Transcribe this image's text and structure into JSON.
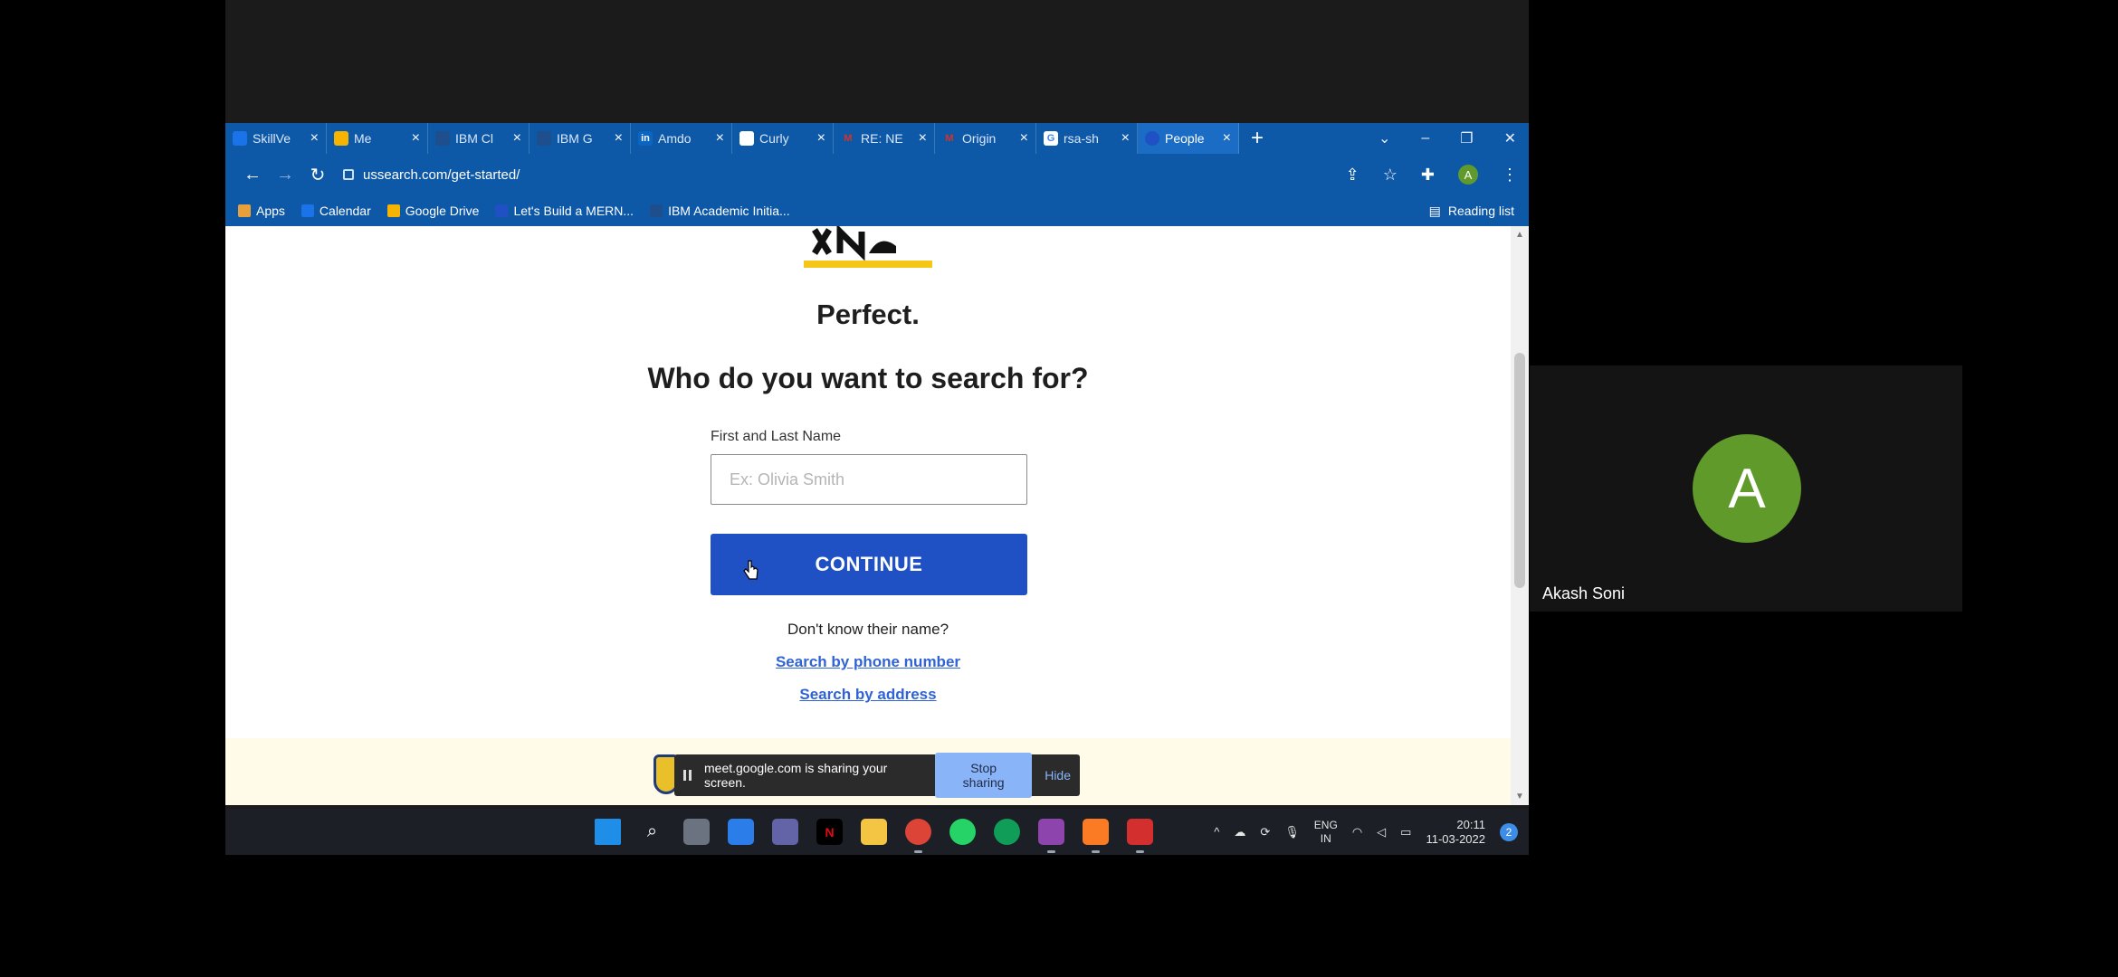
{
  "browser": {
    "tabs": [
      {
        "label": "SkillVe",
        "favicon_color": "#1a73e8"
      },
      {
        "label": "Me",
        "favicon_color": "#f4b400"
      },
      {
        "label": "IBM Cl",
        "favicon_color": "#1f4e8c"
      },
      {
        "label": "IBM G",
        "favicon_color": "#1f4e8c"
      },
      {
        "label": "Amdo",
        "favicon_color": "#0a66c2"
      },
      {
        "label": "Curly",
        "favicon_color": "#ffffff"
      },
      {
        "label": "RE: NE",
        "favicon_color": "#d93025"
      },
      {
        "label": "Origin",
        "favicon_color": "#d93025"
      },
      {
        "label": "rsa-sh",
        "favicon_color": "#ffffff"
      },
      {
        "label": "People",
        "favicon_color": "#1f50c4"
      }
    ],
    "new_tab": "+",
    "url": "ussearch.com/get-started/",
    "profile_initial": "A",
    "bookmarks": [
      {
        "label": "Apps",
        "color": "#e8a13a"
      },
      {
        "label": "Calendar",
        "color": "#1a73e8"
      },
      {
        "label": "Google Drive",
        "color": "#f4b400"
      },
      {
        "label": "Let's Build a MERN...",
        "color": "#1f50c4"
      },
      {
        "label": "IBM Academic Initia...",
        "color": "#1f4e8c"
      }
    ],
    "reading_list": "Reading list"
  },
  "page": {
    "heading_perfect": "Perfect.",
    "question": "Who do you want to search for?",
    "field_label": "First and Last Name",
    "field_placeholder": "Ex: Olivia Smith",
    "continue_label": "CONTINUE",
    "dont_know": "Don't know their name?",
    "link_phone": "Search by phone number",
    "link_address": "Search by address"
  },
  "share_notice": {
    "text": "meet.google.com is sharing your screen.",
    "stop": "Stop sharing",
    "hide": "Hide"
  },
  "taskbar": {
    "lang_line1": "ENG",
    "lang_line2": "IN",
    "time": "20:11",
    "date": "11-03-2022",
    "notifications": "2"
  },
  "participant": {
    "initial": "A",
    "name": "Akash Soni"
  },
  "colors": {
    "chrome_blue": "#0e58a8",
    "continue_blue": "#1f50c4",
    "link_blue": "#2f63d6",
    "avatar_green": "#5f9a2a",
    "logo_yellow": "#f5c518"
  }
}
